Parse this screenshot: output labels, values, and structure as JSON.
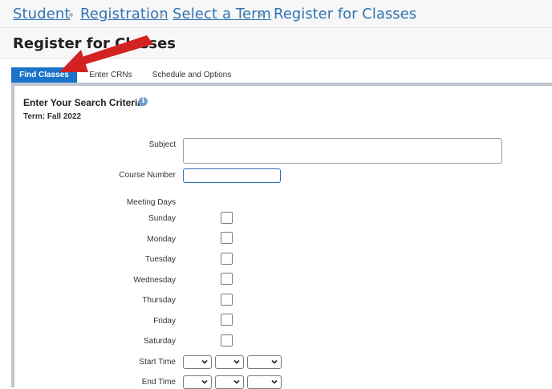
{
  "breadcrumb": {
    "items": [
      "Student",
      "Registration",
      "Select a Term"
    ],
    "current": "Register for Classes"
  },
  "page": {
    "title": "Register for Classes"
  },
  "tabs": [
    "Find Classes",
    "Enter CRNs",
    "Schedule and Options"
  ],
  "search": {
    "heading": "Enter Your Search Criteria",
    "term": "Term: Fall 2022",
    "subject_label": "Subject",
    "course_number_label": "Course Number",
    "meeting_days_label": "Meeting Days",
    "days": [
      "Sunday",
      "Monday",
      "Tuesday",
      "Wednesday",
      "Thursday",
      "Friday",
      "Saturday"
    ],
    "start_time_label": "Start Time",
    "end_time_label": "End Time"
  },
  "colors": {
    "link": "#2f73b3",
    "active_tab": "#1a73c9",
    "arrow": "#d32222"
  }
}
